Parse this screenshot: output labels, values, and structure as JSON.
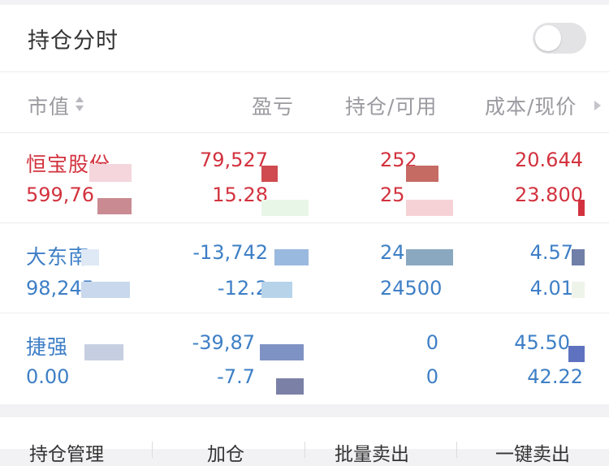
{
  "panel": {
    "title": "持仓分时",
    "toggle_on": false
  },
  "columns": {
    "market_value": "市值",
    "profit_loss": "盈亏",
    "position_available": "持仓/可用",
    "cost_current": "成本/现价"
  },
  "rows": [
    {
      "name": "恒宝股份",
      "market_value": "599,76",
      "profit_loss": "79,527",
      "profit_loss_pct": "15.28",
      "position": "252",
      "available": "25",
      "cost": "20.644",
      "current": "23.800",
      "color": "#d2323e"
    },
    {
      "name": "大东南",
      "market_value": "98,245",
      "profit_loss": "-13,742",
      "profit_loss_pct": "-12.2",
      "position": "24",
      "available": "24500",
      "cost": "4.57",
      "current": "4.01",
      "color": "#3e7fc6"
    },
    {
      "name": "捷强",
      "market_value": "0.00",
      "profit_loss": "-39,87",
      "profit_loss_pct": "-7.7",
      "position": "0",
      "available": "0",
      "cost": "45.50",
      "current": "42.22",
      "color": "#3e7fc6"
    }
  ],
  "bottom_actions": [
    "持仓管理",
    "加仓",
    "批量卖出",
    "一键卖出"
  ]
}
